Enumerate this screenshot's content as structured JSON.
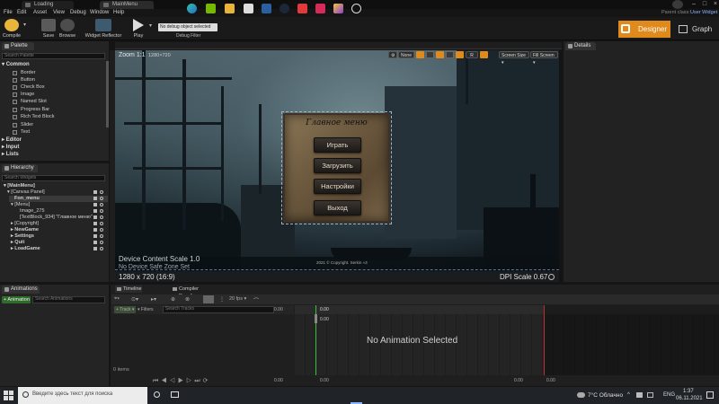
{
  "tabs": [
    {
      "label": "Loading"
    },
    {
      "label": "MainMenu"
    }
  ],
  "parent_class": {
    "label": "Parent class:",
    "value": "User Widget"
  },
  "menu": [
    "File",
    "Edit",
    "Asset",
    "View",
    "Debug",
    "Window",
    "Help"
  ],
  "toolbar": {
    "compile": "Compile",
    "save": "Save",
    "browse": "Browse",
    "widget_reflector": "Widget Reflector",
    "play": "Play",
    "debug_object": "No debug object selected",
    "debug_filter": "Debug Filter",
    "designer": "Designer",
    "graph": "Graph"
  },
  "palette": {
    "tab": "Palette",
    "search_placeholder": "Search Palette",
    "common": "Common",
    "items": [
      "Border",
      "Button",
      "Check Box",
      "Image",
      "Named Slot",
      "Progress Bar",
      "Rich Text Block",
      "Slider",
      "Text"
    ],
    "categories": [
      "Editor",
      "Input",
      "Lists"
    ]
  },
  "hierarchy": {
    "tab": "Hierarchy",
    "search_placeholder": "Search Widgets",
    "items": [
      "[MainMenu]",
      "[Canvas Panel]",
      "Fon_menu",
      "[Menu]",
      "Image_275",
      "[TextBlock_934] \"Главное меню\"",
      "[Copyright]",
      "NewGame",
      "Settings",
      "Quit",
      "LoadGame"
    ]
  },
  "details": {
    "tab": "Details"
  },
  "viewport": {
    "zoom": "Zoom 1:1",
    "coords": "1280×720",
    "none_label": "None",
    "r_label": "R",
    "screen_size": "Screen Size",
    "fill_screen": "Fill Screen",
    "device_scale": "Device Content Scale 1.0",
    "safe_zone": "No Device Safe Zone Set",
    "resolution": "1280 x 720 (16:9)",
    "dpi": "DPI Scale 0.67",
    "copyright": "2021 © Copyright. Serkin «3"
  },
  "game_menu": {
    "title": "Главное меню",
    "buttons": [
      "Играть",
      "Загрузить",
      "Настройки",
      "Выход"
    ]
  },
  "animations": {
    "tab": "Animations",
    "add_button": "+ Animation",
    "search_placeholder": "Search Animations"
  },
  "timeline": {
    "tabs": [
      "Timeline",
      "Compiler Results"
    ],
    "fps": "20 fps",
    "track": "Track",
    "filters": "Filters",
    "search_placeholder": "Search Tracks",
    "time_left": "0.00",
    "time_marker": "0.00",
    "items": "0 items",
    "no_anim": "No Animation Selected"
  },
  "taskbar": {
    "search_placeholder": "Введите здесь текст для поиска",
    "weather": "7°C Облачно",
    "lang": "ENG",
    "time": "1:37",
    "date": "06.11.2021"
  }
}
